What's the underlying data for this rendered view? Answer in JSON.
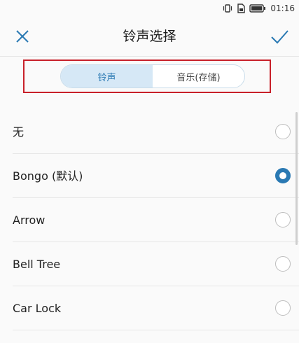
{
  "status_bar": {
    "time": "01:16"
  },
  "header": {
    "title": "铃声选择"
  },
  "tabs": [
    {
      "label": "铃声",
      "active": true
    },
    {
      "label": "音乐(存储)",
      "active": false
    }
  ],
  "ringtones": [
    {
      "label": "无",
      "selected": false
    },
    {
      "label": "Bongo (默认)",
      "selected": true
    },
    {
      "label": "Arrow",
      "selected": false
    },
    {
      "label": "Bell Tree",
      "selected": false
    },
    {
      "label": "Car Lock",
      "selected": false
    }
  ],
  "colors": {
    "accent": "#2a79b3",
    "highlight_border": "#c8202a",
    "tab_active_bg": "#d6e8f6"
  }
}
